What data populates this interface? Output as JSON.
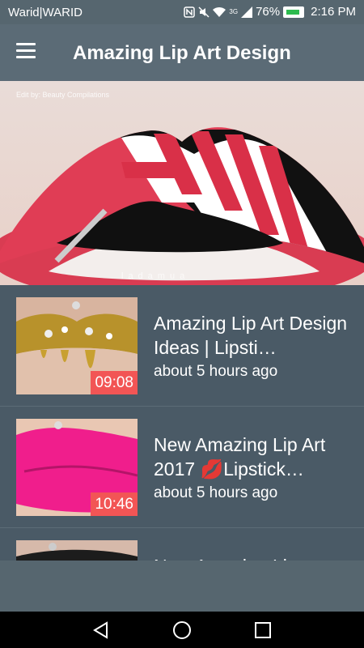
{
  "status": {
    "carrier": "Warid|WARID",
    "battery": "76%",
    "time": "2:16 PM",
    "network": "3G"
  },
  "app_bar": {
    "title": "Amazing Lip Art Design"
  },
  "hero": {
    "credit": "Edit by: Beauty Compilations",
    "watermark": "ladamua"
  },
  "videos": [
    {
      "title": "Amazing Lip Art Design Ideas | Lipsti…",
      "time": "about 5 hours ago",
      "duration": "09:08"
    },
    {
      "title": "New Amazing Lip Art 2017 💋Lipstick…",
      "time": "about 5 hours ago",
      "duration": "10:46"
    },
    {
      "title": "New Amazing Lip",
      "time": "",
      "duration": ""
    }
  ],
  "icons": {
    "menu": "menu-icon",
    "back": "back-icon",
    "home": "home-icon",
    "recents": "recents-icon"
  }
}
